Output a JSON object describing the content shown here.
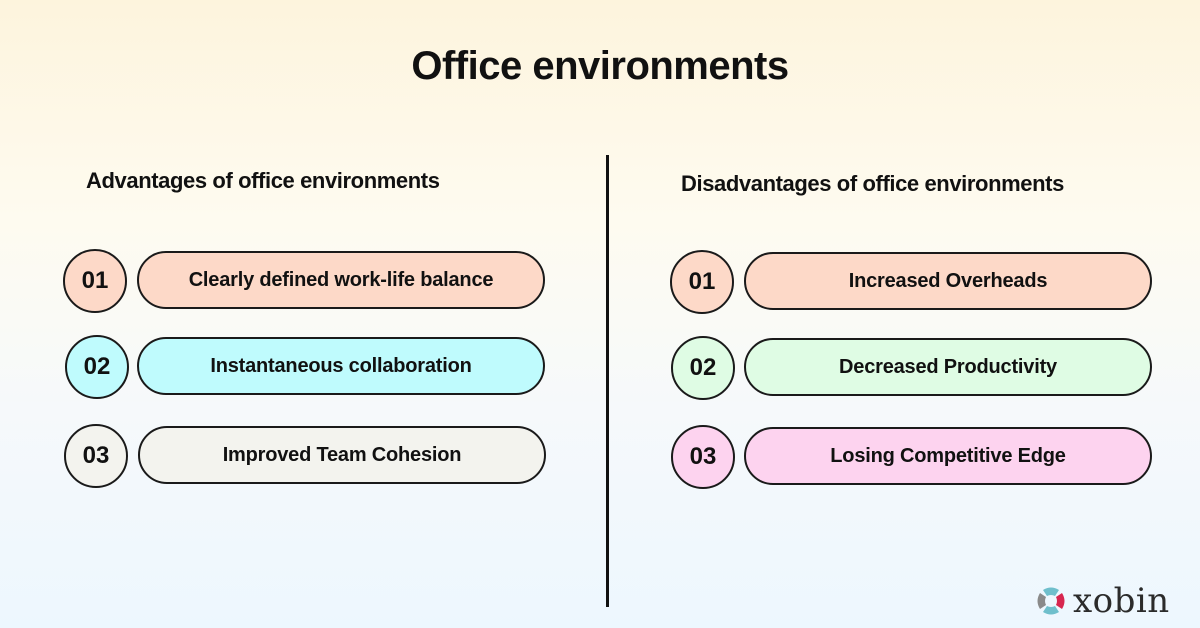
{
  "title": "Office environments",
  "advantages": {
    "heading": "Advantages of office environments",
    "items": [
      {
        "number": "01",
        "label": "Clearly defined work-life balance",
        "color": "#fdd9c8"
      },
      {
        "number": "02",
        "label": "Instantaneous collaboration",
        "color": "#bffbfd"
      },
      {
        "number": "03",
        "label": "Improved Team Cohesion",
        "color": "#f3f3ee"
      }
    ]
  },
  "disadvantages": {
    "heading": "Disadvantages of office environments",
    "items": [
      {
        "number": "01",
        "label": "Increased Overheads",
        "color": "#fdd9c8"
      },
      {
        "number": "02",
        "label": "Decreased Productivity",
        "color": "#dffce4"
      },
      {
        "number": "03",
        "label": "Losing Competitive Edge",
        "color": "#fdd3ef"
      }
    ]
  },
  "brand": {
    "name": "xobin",
    "colors": {
      "teal": "#6fbfcc",
      "crimson": "#d7264f",
      "gray": "#8a8a8a"
    }
  }
}
